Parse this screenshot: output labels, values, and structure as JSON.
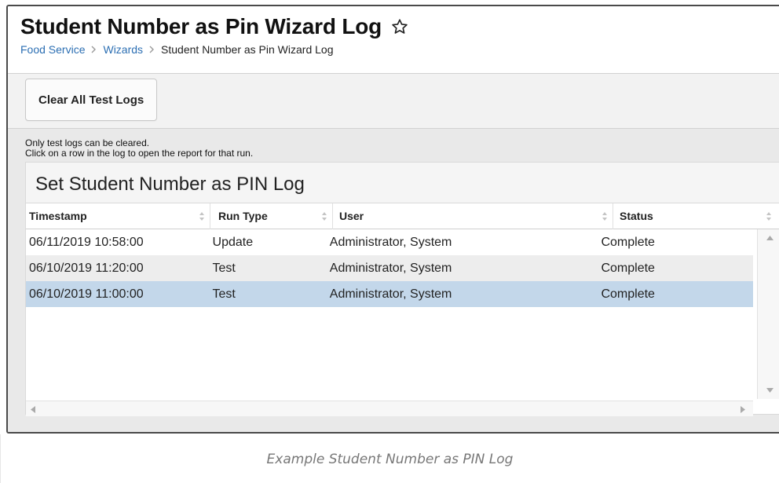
{
  "header": {
    "title": "Student Number as Pin Wizard Log",
    "star_icon": "star-outline-icon",
    "breadcrumb": [
      "Food Service",
      "Wizards",
      "Student Number as Pin Wizard Log"
    ]
  },
  "toolbar": {
    "clear_label": "Clear All Test Logs"
  },
  "info": {
    "line1": "Only test logs can be cleared.",
    "line2": "Click on a row in the log to open the report for that run."
  },
  "panel": {
    "title": "Set Student Number as PIN Log",
    "columns": [
      "Timestamp",
      "Run Type",
      "User",
      "Status"
    ],
    "rows": [
      {
        "timestamp": "06/11/2019 10:58:00",
        "run_type": "Update",
        "user": "Administrator, System",
        "status": "Complete"
      },
      {
        "timestamp": "06/10/2019 11:20:00",
        "run_type": "Test",
        "user": "Administrator, System",
        "status": "Complete"
      },
      {
        "timestamp": "06/10/2019 11:00:00",
        "run_type": "Test",
        "user": "Administrator, System",
        "status": "Complete"
      }
    ],
    "selected_row": 2
  },
  "caption": "Example Student Number as PIN Log",
  "colors": {
    "link": "#2c6fb3",
    "selected_row": "#c3d7ea",
    "alt_row": "#ededed"
  }
}
